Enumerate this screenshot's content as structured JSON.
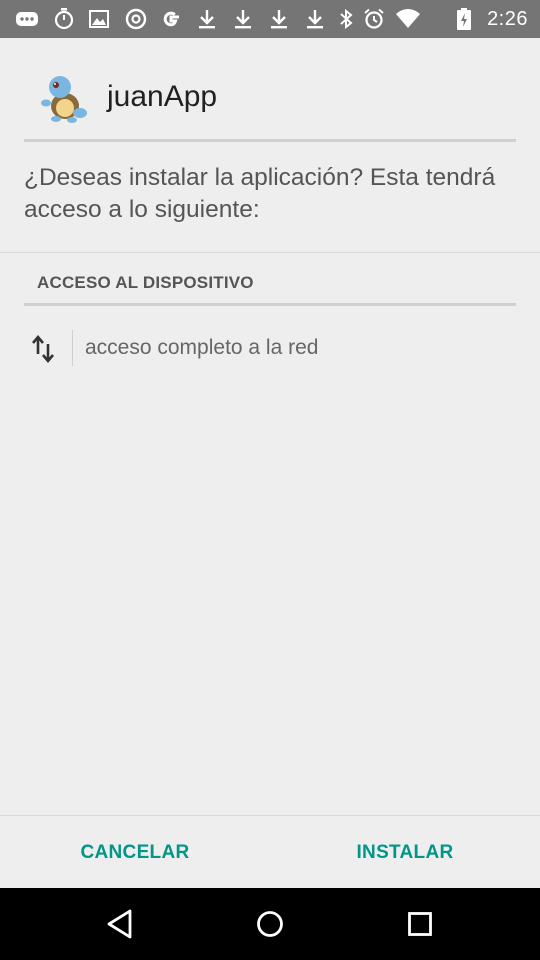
{
  "status_bar": {
    "time": "2:26",
    "icons": [
      "message-icon",
      "stopwatch-icon",
      "image-icon",
      "chrome-icon",
      "google-icon",
      "download-icon",
      "download-icon",
      "download-icon",
      "download-icon",
      "bluetooth-icon",
      "alarm-icon",
      "wifi-icon",
      "battery-icon"
    ]
  },
  "app": {
    "name": "juanApp",
    "icon": "squirtle-app-icon"
  },
  "prompt": {
    "question": "¿Deseas instalar la aplicación? Esta tendrá acceso a lo siguiente:"
  },
  "permissions": {
    "section_title": "ACCESO AL DISPOSITIVO",
    "items": [
      {
        "icon": "network-arrows-icon",
        "label": "acceso completo a la red"
      }
    ]
  },
  "buttons": {
    "cancel": "CANCELAR",
    "install": "INSTALAR"
  },
  "nav_bar": {
    "icons": [
      "back-icon",
      "home-icon",
      "recents-icon"
    ]
  },
  "colors": {
    "accent": "#009688",
    "status_bar": "#757575",
    "background": "#eeeeee"
  }
}
